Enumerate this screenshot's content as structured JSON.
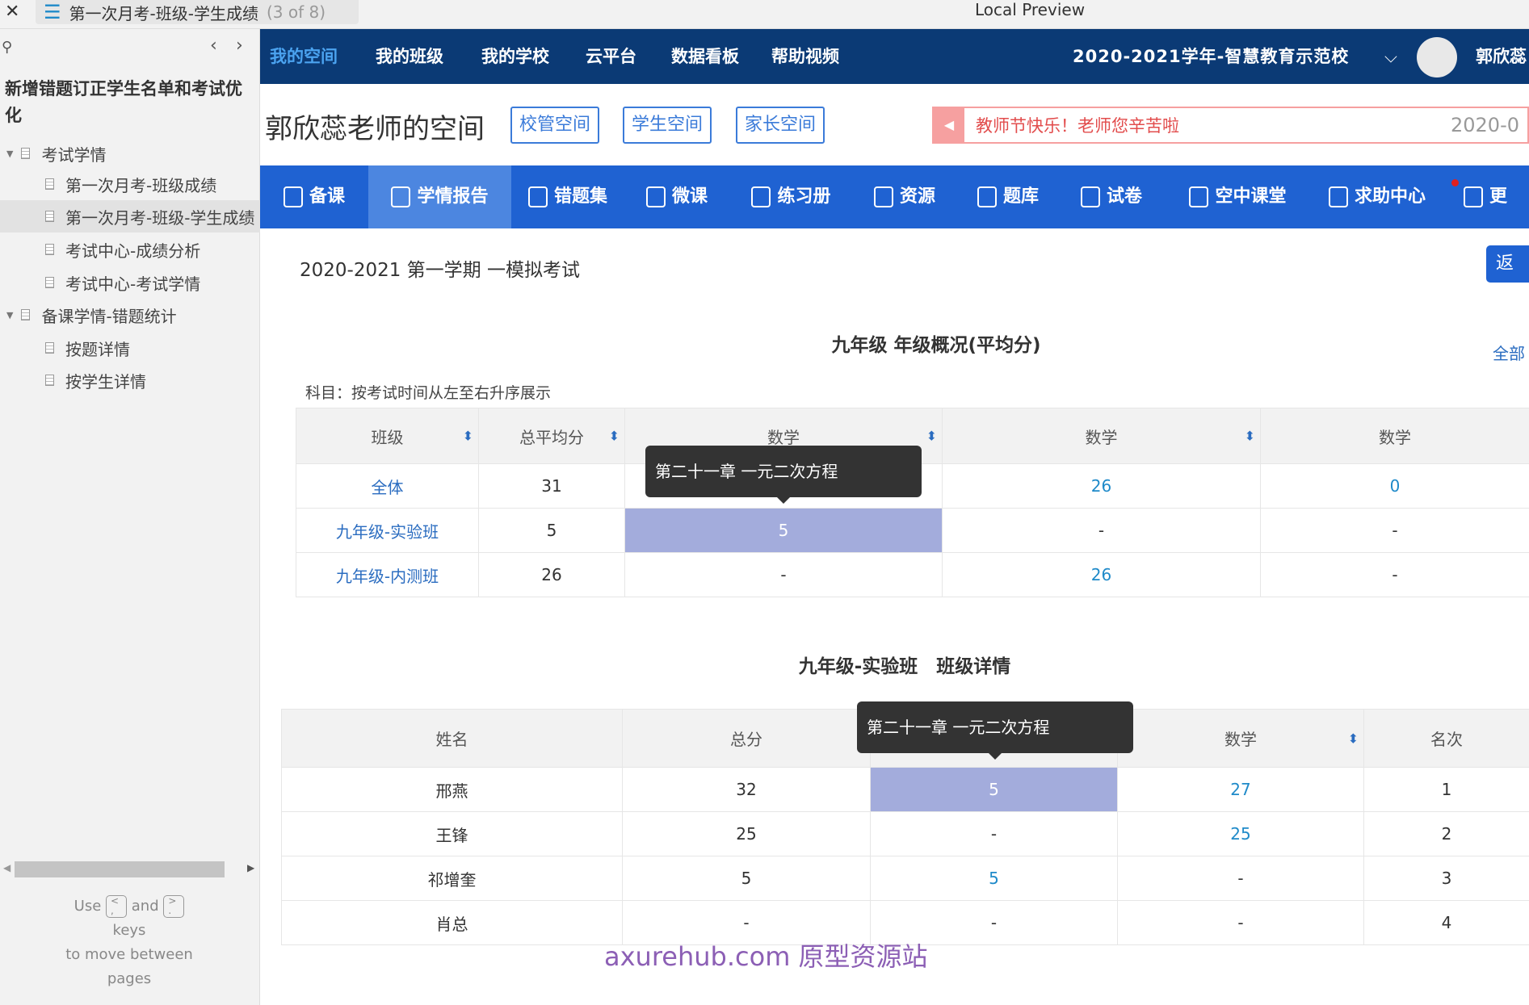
{
  "window": {
    "close": "✕",
    "tab_title": "第一次月考-班级-学生成绩",
    "tab_count": "(3 of 8)",
    "title": "Local Preview"
  },
  "sidebar": {
    "project": "新增错题订正学生名单和考试优化",
    "items": [
      {
        "label": "考试学情",
        "level": 0
      },
      {
        "label": "第一次月考-班级成绩",
        "level": 1
      },
      {
        "label": "第一次月考-班级-学生成绩",
        "level": 1,
        "selected": true
      },
      {
        "label": "考试中心-成绩分析",
        "level": 1
      },
      {
        "label": "考试中心-考试学情",
        "level": 1
      },
      {
        "label": "备课学情-错题统计",
        "level": 0
      },
      {
        "label": "按题详情",
        "level": 1
      },
      {
        "label": "按学生详情",
        "level": 1
      }
    ],
    "hint": {
      "use": "Use",
      "and": "and",
      "keys": "keys",
      "move": "to move between",
      "pages": "pages",
      "prev_key": "<\n,",
      "next_key": ">\n."
    }
  },
  "nav": {
    "items": [
      "我的空间",
      "我的班级",
      "我的学校",
      "云平台",
      "数据看板",
      "帮助视频"
    ],
    "active": "我的空间",
    "school": "2020-2021学年-智慧教育示范校",
    "user": "郭欣蕊"
  },
  "header": {
    "title": "郭欣蕊老师的空间",
    "buttons": [
      "校管空间",
      "学生空间",
      "家长空间"
    ],
    "notice": "教师节快乐！老师您辛苦啦",
    "notice_date": "2020-0"
  },
  "menu": {
    "items": [
      "备课",
      "学情报告",
      "错题集",
      "微课",
      "练习册",
      "资源",
      "题库",
      "试卷",
      "空中课堂",
      "求助中心",
      "更"
    ],
    "active": "学情报告"
  },
  "exam": {
    "title": "2020-2021 第一学期 一模拟考试",
    "back": "返",
    "all": "全部"
  },
  "overview": {
    "title": "九年级 年级概况(平均分)",
    "note": "科目：按考试时间从左至右升序展示",
    "headers": [
      "班级",
      "总平均分",
      "数学",
      "数学",
      "数学"
    ],
    "rows": [
      [
        "全体",
        "31",
        "",
        "26",
        "0"
      ],
      [
        "九年级-实验班",
        "5",
        "5",
        "-",
        "-"
      ],
      [
        "九年级-内测班",
        "26",
        "-",
        "26",
        "-"
      ]
    ],
    "tooltip": "第二十一章 一元二次方程"
  },
  "detail": {
    "title": "九年级-实验班　班级详情",
    "headers": [
      "姓名",
      "总分",
      "数学",
      "数学",
      "名次"
    ],
    "rows": [
      [
        "邢燕",
        "32",
        "5",
        "27",
        "1"
      ],
      [
        "王锋",
        "25",
        "-",
        "25",
        "2"
      ],
      [
        "祁增奎",
        "5",
        "5",
        "-",
        "3"
      ],
      [
        "肖总",
        "-",
        "-",
        "-",
        "4"
      ]
    ],
    "tooltip": "第二十一章 一元二次方程"
  },
  "watermark": "axurehub.com 原型资源站",
  "colors": {
    "nav": "#0b3a75",
    "menu": "#1f62d2",
    "highlight": "#a3acdc",
    "link": "#1f8ac9"
  }
}
